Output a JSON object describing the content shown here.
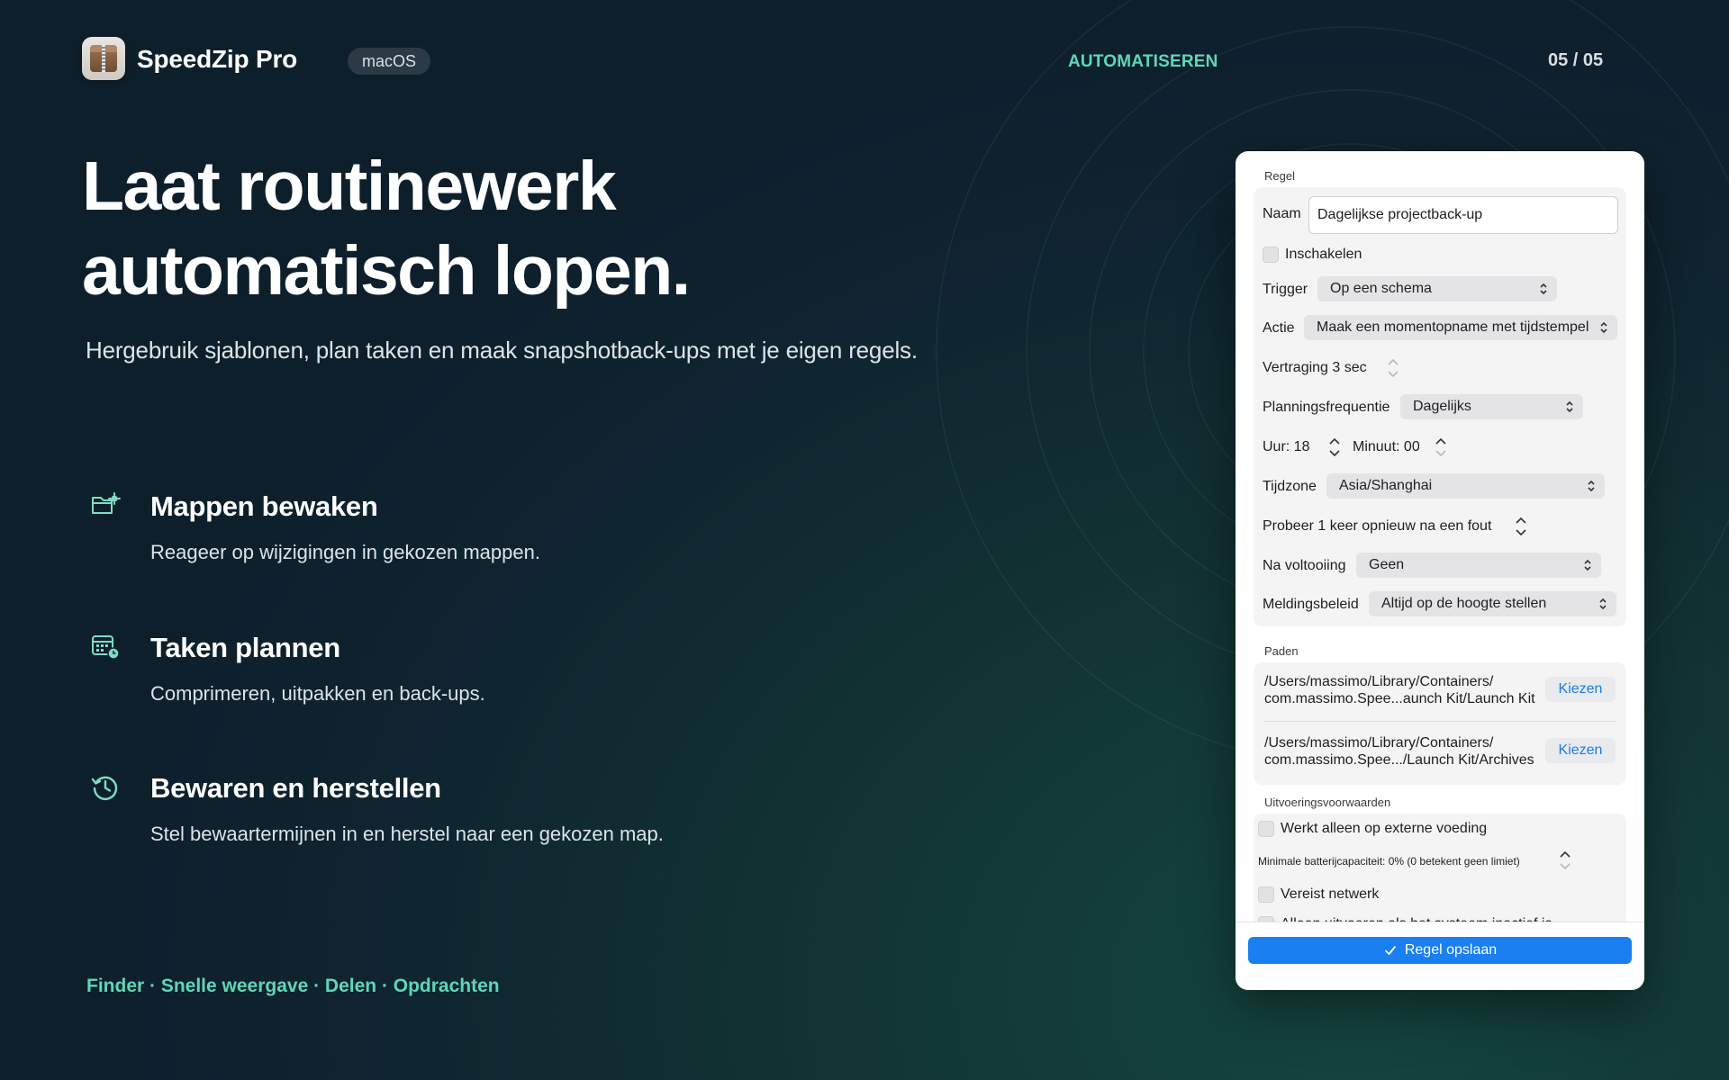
{
  "app": {
    "name": "SpeedZip Pro",
    "platform": "macOS"
  },
  "header": {
    "section": "AUTOMATISEREN",
    "page_count": "05 / 05"
  },
  "hero": {
    "headline_line1": "Laat routinewerk",
    "headline_line2": "automatisch lopen.",
    "subline": "Hergebruik sjablonen, plan taken en maak snapshotback-ups met je eigen regels."
  },
  "features": [
    {
      "icon": "folder-gear-icon",
      "title": "Mappen bewaken",
      "desc": "Reageer op wijzigingen in gekozen mappen."
    },
    {
      "icon": "calendar-clock-icon",
      "title": "Taken plannen",
      "desc": "Comprimeren, uitpakken en back-ups."
    },
    {
      "icon": "history-icon",
      "title": "Bewaren en herstellen",
      "desc": "Stel bewaartermijnen in en herstel naar een gekozen map."
    }
  ],
  "footer": {
    "links": "Finder · Snelle weergave · Delen · Opdrachten"
  },
  "panel": {
    "rule_group": "Regel",
    "name_label": "Naam",
    "name_value": "Dagelijkse projectback-up",
    "enable_label": "Inschakelen",
    "trigger_label": "Trigger",
    "trigger_value": "Op een schema",
    "action_label": "Actie",
    "action_value": "Maak een momentopname met tijdstempel",
    "delay_label": "Vertraging 3 sec",
    "frequency_label": "Planningsfrequentie",
    "frequency_value": "Dagelijks",
    "hour_label": "Uur: 18",
    "minute_label": "Minuut: 00",
    "timezone_label": "Tijdzone",
    "timezone_value": "Asia/Shanghai",
    "retry_label": "Probeer 1 keer opnieuw na een fout",
    "after_label": "Na voltooiing",
    "after_value": "Geen",
    "notify_label": "Meldingsbeleid",
    "notify_value": "Altijd op de hoogte stellen",
    "paths_group": "Paden",
    "path1_line1": "/Users/massimo/Library/Containers/",
    "path1_line2": "com.massimo.Spee...aunch Kit/Launch Kit",
    "path2_line1": "/Users/massimo/Library/Containers/",
    "path2_line2": "com.massimo.Spee.../Launch Kit/Archives",
    "choose_label": "Kiezen",
    "conditions_group": "Uitvoeringsvoorwaarden",
    "external_power_label": "Werkt alleen op externe voeding",
    "battery_label": "Minimale batterijcapaciteit: 0% (0 betekent geen limiet)",
    "network_label": "Vereist netwerk",
    "idle_label": "Alleen uitvoeren als het systeem inactief is",
    "save_label": "Regel opslaan"
  }
}
